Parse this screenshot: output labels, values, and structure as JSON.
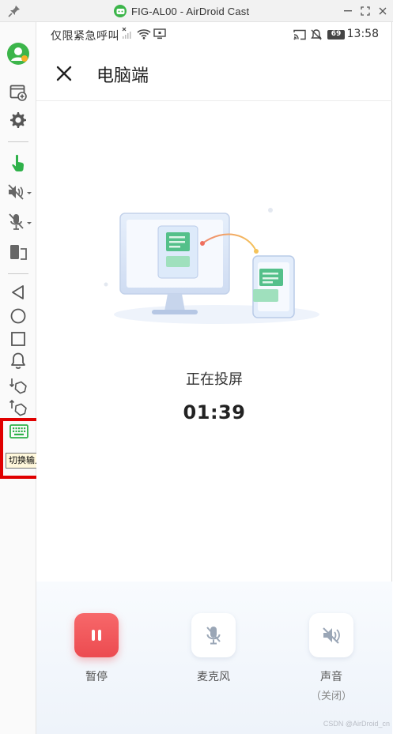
{
  "window": {
    "title": "FIG-AL00 - AirDroid Cast",
    "controls": [
      "minimize",
      "maximize",
      "close"
    ]
  },
  "toolbar": {
    "items": [
      {
        "icon": "user-avatar-icon"
      },
      {
        "icon": "add-window-icon"
      },
      {
        "icon": "gear-icon"
      },
      {
        "icon": "touch-control-icon"
      },
      {
        "icon": "speaker-muted-icon"
      },
      {
        "icon": "microphone-muted-icon"
      },
      {
        "icon": "screen-rotate-icon"
      },
      {
        "icon": "back-triangle-icon"
      },
      {
        "icon": "home-circle-icon"
      },
      {
        "icon": "recents-square-icon"
      },
      {
        "icon": "notification-bell-icon"
      },
      {
        "icon": "swipe-down-icon"
      },
      {
        "icon": "swipe-up-icon"
      },
      {
        "icon": "keyboard-icon"
      }
    ],
    "tooltip": "切换输入法",
    "accent_color": "#3cb54a",
    "highlight_color": "#e00000"
  },
  "phone": {
    "status_bar": {
      "carrier": "仅限紧急呼叫",
      "battery": "69",
      "time": "13:58"
    },
    "header": {
      "title": "电脑端"
    },
    "casting": {
      "status": "正在投屏",
      "elapsed": "01:39"
    },
    "controls": [
      {
        "label": "暂停",
        "sub": "",
        "icon": "pause-icon",
        "color": "#ec4b50"
      },
      {
        "label": "麦克风",
        "sub": "",
        "icon": "microphone-muted-icon"
      },
      {
        "label": "声音",
        "sub": "（关闭）",
        "icon": "speaker-muted-icon"
      }
    ]
  },
  "watermark": "CSDN @AirDroid_cn"
}
